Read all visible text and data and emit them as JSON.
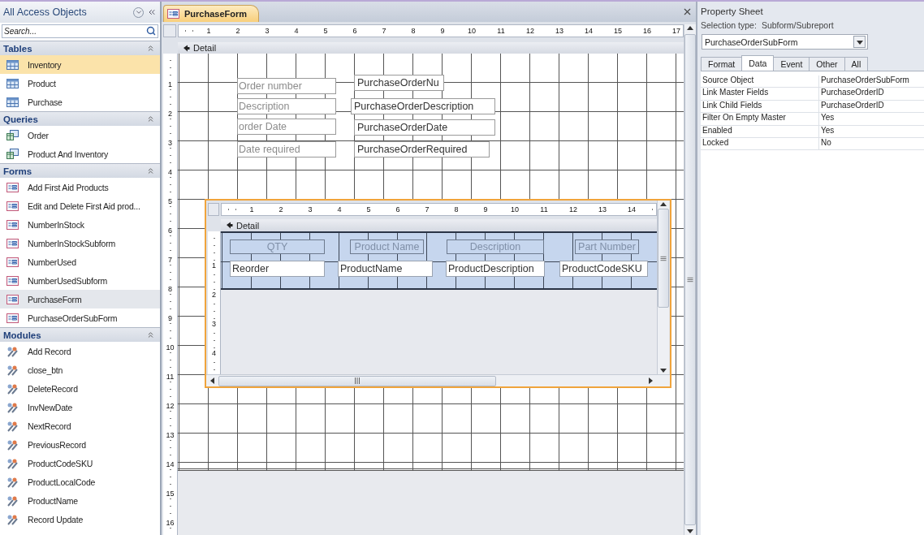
{
  "nav": {
    "title": "All Access Objects",
    "search": {
      "placeholder": "Search..."
    },
    "groups": [
      {
        "title": "Tables",
        "kind": "table",
        "expanded": true,
        "items": [
          {
            "label": "Inventory",
            "selected": true,
            "active": false
          },
          {
            "label": "Product",
            "selected": false,
            "active": false
          },
          {
            "label": "Purchase",
            "selected": false,
            "active": false
          }
        ]
      },
      {
        "title": "Queries",
        "kind": "query",
        "expanded": true,
        "items": [
          {
            "label": "Order",
            "selected": false,
            "active": false
          },
          {
            "label": "Product And Inventory",
            "selected": false,
            "active": false
          }
        ]
      },
      {
        "title": "Forms",
        "kind": "form",
        "expanded": true,
        "items": [
          {
            "label": "Add First Aid Products",
            "selected": false,
            "active": false
          },
          {
            "label": "Edit and Delete First Aid prod...",
            "selected": false,
            "active": false
          },
          {
            "label": "NumberInStock",
            "selected": false,
            "active": false
          },
          {
            "label": "NumberInStockSubform",
            "selected": false,
            "active": false
          },
          {
            "label": "NumberUsed",
            "selected": false,
            "active": false
          },
          {
            "label": "NumberUsedSubform",
            "selected": false,
            "active": false
          },
          {
            "label": "PurchaseForm",
            "selected": false,
            "active": true
          },
          {
            "label": "PurchaseOrderSubForm",
            "selected": false,
            "active": false
          }
        ]
      },
      {
        "title": "Modules",
        "kind": "module",
        "expanded": true,
        "items": [
          {
            "label": "Add Record",
            "selected": false,
            "active": false
          },
          {
            "label": "close_btn",
            "selected": false,
            "active": false
          },
          {
            "label": "DeleteRecord",
            "selected": false,
            "active": false
          },
          {
            "label": "InvNewDate",
            "selected": false,
            "active": false
          },
          {
            "label": "NextRecord",
            "selected": false,
            "active": false
          },
          {
            "label": "PreviousRecord",
            "selected": false,
            "active": false
          },
          {
            "label": "ProductCodeSKU",
            "selected": false,
            "active": false
          },
          {
            "label": "ProductLocalCode",
            "selected": false,
            "active": false
          },
          {
            "label": "ProductName",
            "selected": false,
            "active": false
          },
          {
            "label": "Record Update",
            "selected": false,
            "active": false
          }
        ]
      }
    ]
  },
  "document": {
    "tab": {
      "label": "PurchaseForm",
      "selected": true
    },
    "ruler": {
      "columns": [
        "1",
        "2",
        "3",
        "4",
        "5",
        "6",
        "7",
        "8",
        "9",
        "10",
        "11",
        "12",
        "13",
        "14",
        "15",
        "16",
        "17"
      ],
      "rows": [
        "1",
        "2",
        "3",
        "4",
        "5",
        "6",
        "7",
        "8",
        "9",
        "10",
        "11",
        "12",
        "13",
        "14",
        "15",
        "16"
      ]
    },
    "section": "Detail",
    "rows": [
      {
        "label": "Order number",
        "field": "PurchaseOrderNu"
      },
      {
        "label": "Description",
        "field": "PurchaseOrderDescription"
      },
      {
        "label": "order Date",
        "field": "PurchaseOrderDate"
      },
      {
        "label": "Date required",
        "field": "PurchaseOrderRequired"
      }
    ],
    "subform": {
      "selected": true,
      "ruler": {
        "columns": [
          "1",
          "2",
          "3",
          "4",
          "5",
          "6",
          "7",
          "8",
          "9",
          "10",
          "11",
          "12",
          "13",
          "14"
        ],
        "rows": [
          "1",
          "2",
          "3",
          "4"
        ]
      },
      "section": "Detail",
      "columns": [
        {
          "header": "QTY",
          "field": "Reorder"
        },
        {
          "header": "Product Name",
          "field": "ProductName"
        },
        {
          "header": "Description",
          "field": "ProductDescription"
        },
        {
          "header": "Part Number",
          "field": "ProductCodeSKU"
        }
      ]
    }
  },
  "property_sheet": {
    "title": "Property Sheet",
    "selection_type_label": "Selection type:",
    "selection_type": "Subform/Subreport",
    "object": "PurchaseOrderSubForm",
    "tabs": [
      {
        "label": "Format",
        "selected": false
      },
      {
        "label": "Data",
        "selected": true
      },
      {
        "label": "Event",
        "selected": false
      },
      {
        "label": "Other",
        "selected": false
      },
      {
        "label": "All",
        "selected": false
      }
    ],
    "properties": [
      {
        "name": "Source Object",
        "value": "PurchaseOrderSubForm"
      },
      {
        "name": "Link Master Fields",
        "value": "PurchaseOrderID"
      },
      {
        "name": "Link Child Fields",
        "value": "PurchaseOrderID"
      },
      {
        "name": "Filter On Empty Master",
        "value": "Yes"
      },
      {
        "name": "Enabled",
        "value": "Yes"
      },
      {
        "name": "Locked",
        "value": "No"
      }
    ]
  }
}
